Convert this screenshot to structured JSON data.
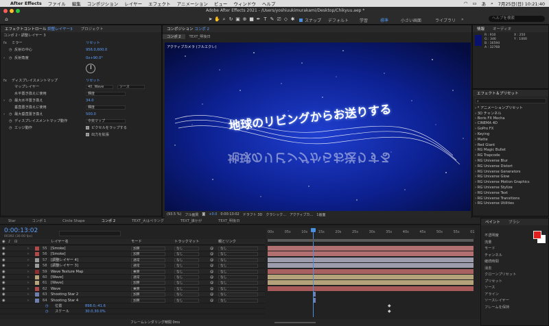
{
  "menubar": {
    "apple": "",
    "app": "After Effects",
    "items": [
      "ファイル",
      "編集",
      "コンポジション",
      "レイヤー",
      "エフェクト",
      "アニメーション",
      "ビュー",
      "ウィンドウ",
      "ヘルプ"
    ],
    "clock": "7月25日(日)  10:21:40",
    "lang": "あ"
  },
  "window": {
    "title": "Adobe After Effects 2021 - /Users/yoshiuukimurakami/Desktop/Chikyuu.aep *",
    "snap_label": "スナップ",
    "workspaces": [
      "デフォルト",
      "学習",
      "標準",
      "小さい画面",
      "ライブラリ"
    ],
    "active_workspace": "標準",
    "search_placeholder": "ヘルプを検索"
  },
  "effects_panel": {
    "tab": "エフェクトコントロール",
    "tab_layer": "調整レイヤー3",
    "tab2": "プロジェクト",
    "breadcrumb": "コンポ 2・調整レイヤー 3",
    "rows": [
      {
        "label": "ミラー",
        "value": "",
        "kind": "section"
      },
      {
        "label": "反射の中心",
        "value": "956.0,600.0",
        "kind": "val"
      },
      {
        "label": "反射角度",
        "value": "0x+90.0°",
        "kind": "val"
      },
      {
        "label": "",
        "value": "",
        "kind": "dial"
      },
      {
        "label": "ディスプレイスメントマップ",
        "value": "",
        "kind": "section"
      },
      {
        "label": "マップレイヤー",
        "value": "40. Wave",
        "kind": "dd",
        "value2": "ソース"
      },
      {
        "label": "水平置き換えに使用",
        "value": "輝度",
        "kind": "dd"
      },
      {
        "label": "最大水平置き換え",
        "value": "34.0",
        "kind": "val"
      },
      {
        "label": "垂直置き換えに使用",
        "value": "輝度",
        "kind": "dd"
      },
      {
        "label": "最大垂直置き換え",
        "value": "500.0",
        "kind": "val"
      },
      {
        "label": "ディスプレイスメントマップ動作",
        "value": "中央マップ",
        "kind": "dd"
      },
      {
        "label": "エッジ動作",
        "value": "ピクセルをラップする",
        "kind": "chk"
      },
      {
        "label": "",
        "value": "出力を拡張",
        "kind": "chk"
      }
    ],
    "reset": "リセット"
  },
  "composition": {
    "tab": "コンポジション",
    "tab_name": "コンポ 2",
    "subtabs": [
      "コンポ 2",
      "TEXT_明後日"
    ],
    "camera_label": "アクティブカメラ (フルエクレ)",
    "text": "地球のリビングからお送りする",
    "toolbar": [
      "(93.5 %)",
      "フル画質",
      "+0.0",
      "0:00:13:02",
      "ドラフト 3D",
      "クラシック...",
      "アクティブカ...",
      "1画面"
    ]
  },
  "info": {
    "tab": "情報",
    "tab2": "オーディオ",
    "rgb": [
      "R : 910",
      "G : 346",
      "B : 16594",
      "A : 32768"
    ],
    "xy": [
      "X : 250",
      "Y : 1000"
    ]
  },
  "effects_presets": {
    "tab": "エフェクト＆プリセット",
    "items": [
      "* アニメーションプリセット",
      "3D チャンネル",
      "Boris FX Mocha",
      "CINEMA 4D",
      "GoPro FX",
      "Keying",
      "Matte",
      "Red Giant",
      "RG Magic Bullet",
      "RG Trapcode",
      "RG Universe Blur",
      "RG Universe Distort",
      "RG Universe Generators",
      "RG Universe Glow",
      "RG Universe Motion Graphics",
      "RG Universe Stylize",
      "RG Universe Text",
      "RG Universe Transitions",
      "RG Universe Utilities"
    ]
  },
  "timeline": {
    "tabs": [
      "Star",
      "コンポ 1",
      "Circle Shape",
      "コンポ 2",
      "TEXT_大はペラング",
      "TEXT_誰かが",
      "TEXT_明後日"
    ],
    "active_tab": "コンポ 2",
    "timecode": "0:00:13:02",
    "fps": "00392 (30.00 fps)",
    "headers": {
      "name": "レイヤー名",
      "mode": "モード",
      "track": "トラックマット",
      "parent": "親とリンク"
    },
    "ruler": [
      "00s",
      "05s",
      "10s",
      "15s",
      "20s",
      "25s",
      "30s",
      "35s",
      "40s",
      "45s",
      "50s",
      "55s",
      "01"
    ],
    "layers": [
      {
        "num": "55",
        "name": "[Smoke]",
        "color": "#b04a4a",
        "mode": "加算",
        "track": "なし",
        "parent": "なし",
        "bar": "#b27070"
      },
      {
        "num": "56",
        "name": "[Smoke]",
        "color": "#b04a4a",
        "mode": "加算",
        "track": "なし",
        "parent": "なし",
        "bar": "#b27070"
      },
      {
        "num": "57",
        "name": "[調整レイヤー 4]",
        "color": "#9c9c9c",
        "mode": "通常",
        "track": "なし",
        "parent": "なし",
        "bar": "#9c9cac"
      },
      {
        "num": "58",
        "name": "[調整レイヤー 3]",
        "color": "#9c9c9c",
        "mode": "通常",
        "track": "なし",
        "parent": "なし",
        "bar": "#9c9cac"
      },
      {
        "num": "59",
        "name": "Wave Texture Map",
        "color": "#8e2f2f",
        "mode": "乗算",
        "track": "なし",
        "parent": "なし",
        "bar": "#a86060"
      },
      {
        "num": "60",
        "name": "[Wave]",
        "color": "#b8a57a",
        "mode": "通常",
        "track": "なし",
        "parent": "なし",
        "bar": "#b4a27a"
      },
      {
        "num": "61",
        "name": "[Wave]",
        "color": "#b8a57a",
        "mode": "加算",
        "track": "なし",
        "parent": "なし",
        "bar": "#b4a27a"
      },
      {
        "num": "62",
        "name": "Wave",
        "color": "#b04a4a",
        "mode": "乗算",
        "track": "なし",
        "parent": "なし",
        "bar": "#a85a5a"
      },
      {
        "num": "63",
        "name": "Shooting Star 2",
        "color": "#6f7fb0",
        "mode": "加算",
        "track": "なし",
        "parent": "なし",
        "bar": ""
      },
      {
        "num": "64",
        "name": "Shooting Star 4",
        "color": "#6f7fb0",
        "mode": "加算",
        "track": "なし",
        "parent": "なし",
        "bar": ""
      }
    ],
    "props": [
      {
        "name": "位置",
        "value": "898.0,-41.6"
      },
      {
        "name": "スケール",
        "value": "30.0,30.0%"
      }
    ],
    "footer": "フレームレンダリング時間 0ms"
  },
  "right_panel": {
    "tabs": [
      "ペイント",
      "ブラシ"
    ],
    "rows": [
      "不透明度",
      "流量",
      "モード",
      "チャンネル",
      "継続時間",
      "消去",
      "クローンプリセット",
      "プリセット",
      "ソース",
      "アライン",
      "ソースレイヤー",
      "フレームを保持"
    ],
    "source_value": "レイヤーソース",
    "mode_value": "通常",
    "channel_value": "RGBA",
    "duration_value": "一定",
    "foreground_color": "#e02020",
    "background_color": "#ffffff"
  }
}
